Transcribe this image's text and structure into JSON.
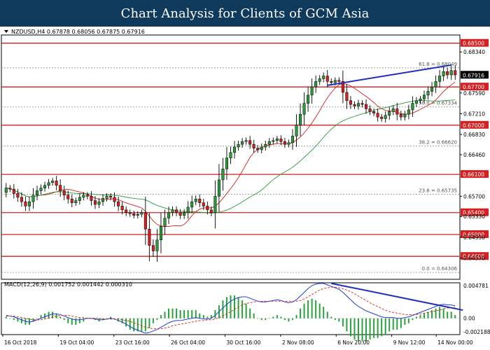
{
  "banner": {
    "title": "Chart Analysis for Clients of GCM Asia"
  },
  "chart_data": [
    {
      "type": "candlestick",
      "symbol_header": "NZDUSD,H4  0.67878 0.68056 0.67875 0.67916",
      "last_price": "0.67916",
      "ylim": [
        0.6418,
        0.6865
      ],
      "x_ticks": [
        "16 Oct 2018",
        "19 Oct 04:00",
        "23 Oct 16:00",
        "26 Oct 04:00",
        "30 Oct 16:00",
        "2 Nov 08:00",
        "6 Nov 20:00",
        "9 Nov 12:00",
        "14 Nov 00:00"
      ],
      "y_ticks": [
        "0.68340",
        "0.67590",
        "0.67210",
        "0.66830",
        "0.66460",
        "0.65700",
        "0.65330",
        "0.64950",
        "0.64570",
        "0.64200"
      ],
      "horizontal_levels": [
        {
          "label": "0.68500",
          "value": 0.685
        },
        {
          "label": "0.67700",
          "value": 0.677
        },
        {
          "label": "0.67000",
          "value": 0.67
        },
        {
          "label": "0.66100",
          "value": 0.661
        },
        {
          "label": "0.65400",
          "value": 0.654
        },
        {
          "label": "0.65000",
          "value": 0.65
        },
        {
          "label": "0.64600",
          "value": 0.646
        }
      ],
      "fibonacci": [
        {
          "label": "61.8 = 0.68049",
          "value": 0.68049
        },
        {
          "label": "50.0 = 0.67334",
          "value": 0.67334
        },
        {
          "label": "38.2 = 0.66620",
          "value": 0.6662
        },
        {
          "label": "23.6 = 0.65735",
          "value": 0.65735
        },
        {
          "label": "0.0 = 0.64306",
          "value": 0.64306
        }
      ],
      "trendline": {
        "from": [
          83,
          0.6773
        ],
        "to": [
          115,
          0.681
        ]
      },
      "moving_average_colors": [
        "#d42020",
        "#2a9a3a"
      ],
      "closes": [
        0.6585,
        0.6583,
        0.6575,
        0.6568,
        0.656,
        0.6552,
        0.656,
        0.6572,
        0.658,
        0.6585,
        0.659,
        0.6595,
        0.6598,
        0.659,
        0.658,
        0.6572,
        0.6565,
        0.6558,
        0.6562,
        0.6568,
        0.6572,
        0.657,
        0.6562,
        0.6555,
        0.656,
        0.6566,
        0.657,
        0.6568,
        0.656,
        0.6552,
        0.6545,
        0.654,
        0.6538,
        0.6535,
        0.6537,
        0.654,
        0.651,
        0.648,
        0.647,
        0.649,
        0.6515,
        0.653,
        0.654,
        0.6545,
        0.654,
        0.6535,
        0.654,
        0.655,
        0.656,
        0.6565,
        0.6558,
        0.6552,
        0.6545,
        0.654,
        0.657,
        0.66,
        0.662,
        0.664,
        0.665,
        0.666,
        0.6665,
        0.667,
        0.6672,
        0.6665,
        0.6658,
        0.6655,
        0.666,
        0.6665,
        0.667,
        0.6672,
        0.6675,
        0.667,
        0.6665,
        0.6668,
        0.668,
        0.67,
        0.672,
        0.674,
        0.6755,
        0.677,
        0.678,
        0.6785,
        0.679,
        0.678,
        0.6778,
        0.6782,
        0.678,
        0.676,
        0.6745,
        0.6738,
        0.6735,
        0.674,
        0.6738,
        0.673,
        0.6725,
        0.6722,
        0.6715,
        0.6712,
        0.6718,
        0.6725,
        0.673,
        0.672,
        0.6715,
        0.672,
        0.6728,
        0.674,
        0.6745,
        0.6748,
        0.6755,
        0.6762,
        0.677,
        0.678,
        0.679,
        0.6798,
        0.6792,
        0.68,
        0.6792
      ],
      "macd": {
        "label": "MACD(12,26,9) 0.001752 0.001442 0.000310",
        "y_ticks": [
          "0.004781",
          "0.00",
          "-0.002188"
        ],
        "ylim": [
          -0.00219,
          0.00478
        ],
        "main": [
          0.0004,
          0.0003,
          0.0002,
          0.0,
          -0.0002,
          -0.0004,
          -0.0005,
          -0.0004,
          -0.0002,
          0.0,
          0.0002,
          0.0004,
          0.0006,
          0.0006,
          0.0005,
          0.0003,
          0.0001,
          -0.0001,
          -0.0002,
          -0.0002,
          -0.0001,
          0.0,
          0.0,
          -0.0001,
          -0.0002,
          -0.0002,
          -0.0001,
          0.0,
          -0.0001,
          -0.0003,
          -0.0005,
          -0.0008,
          -0.0011,
          -0.0014,
          -0.0016,
          -0.0018,
          -0.002,
          -0.0019,
          -0.0017,
          -0.0015,
          -0.0012,
          -0.0009,
          -0.0006,
          -0.0004,
          -0.0003,
          -0.0003,
          -0.0002,
          -0.0001,
          0.0,
          0.0001,
          0.0,
          -0.0001,
          -0.0001,
          0.0,
          0.0004,
          0.0009,
          0.0014,
          0.0019,
          0.0023,
          0.0026,
          0.0028,
          0.0029,
          0.0029,
          0.0027,
          0.0025,
          0.0023,
          0.0022,
          0.0022,
          0.0023,
          0.0024,
          0.0025,
          0.0024,
          0.0022,
          0.0021,
          0.0022,
          0.0025,
          0.003,
          0.0035,
          0.004,
          0.0044,
          0.0046,
          0.0047,
          0.0047,
          0.0045,
          0.0043,
          0.0041,
          0.0039,
          0.0035,
          0.003,
          0.0025,
          0.002,
          0.0016,
          0.0013,
          0.001,
          0.0008,
          0.0006,
          0.0004,
          0.0002,
          0.0001,
          0.0001,
          0.0001,
          0.0,
          0.0,
          0.0001,
          0.0002,
          0.0004,
          0.0006,
          0.0008,
          0.001,
          0.0012,
          0.0014,
          0.0016,
          0.0018,
          0.0019,
          0.0018,
          0.0018,
          0.0017
        ],
        "signal": [
          0.0003,
          0.0003,
          0.0003,
          0.0002,
          0.0001,
          0.0,
          -0.0001,
          -0.0002,
          -0.0002,
          -0.0002,
          -0.0001,
          0.0,
          0.0002,
          0.0003,
          0.0004,
          0.0004,
          0.0004,
          0.0003,
          0.0002,
          0.0001,
          0.0001,
          0.0,
          0.0,
          0.0,
          0.0,
          -0.0001,
          -0.0001,
          -0.0001,
          -0.0001,
          -0.0001,
          -0.0002,
          -0.0003,
          -0.0004,
          -0.0006,
          -0.0008,
          -0.001,
          -0.0012,
          -0.0013,
          -0.0014,
          -0.0014,
          -0.0014,
          -0.0013,
          -0.0012,
          -0.001,
          -0.0009,
          -0.0008,
          -0.0007,
          -0.0006,
          -0.0005,
          -0.0004,
          -0.0003,
          -0.0003,
          -0.0002,
          -0.0002,
          -0.0001,
          0.0001,
          0.0003,
          0.0006,
          0.0009,
          0.0012,
          0.0015,
          0.0018,
          0.002,
          0.0021,
          0.0022,
          0.0023,
          0.0023,
          0.0023,
          0.0023,
          0.0023,
          0.0023,
          0.0023,
          0.0023,
          0.0023,
          0.0023,
          0.0023,
          0.0024,
          0.0026,
          0.0029,
          0.0032,
          0.0035,
          0.0038,
          0.004,
          0.0041,
          0.0042,
          0.0042,
          0.0041,
          0.004,
          0.0038,
          0.0036,
          0.0033,
          0.003,
          0.0027,
          0.0024,
          0.0021,
          0.0018,
          0.0016,
          0.0013,
          0.0011,
          0.0009,
          0.0008,
          0.0007,
          0.0006,
          0.0005,
          0.0005,
          0.0005,
          0.0005,
          0.0006,
          0.0007,
          0.0008,
          0.0009,
          0.001,
          0.0011,
          0.0013,
          0.0014,
          0.0014,
          0.0015
        ],
        "trendline": {
          "from": [
            84,
            0.0047
          ],
          "to": [
            118,
            0.0011
          ]
        },
        "colors": {
          "main": "#1f3fd6",
          "signal": "#d42020",
          "histogram": "#27a33a"
        }
      }
    }
  ],
  "colors": {
    "banner": "#0f3a5c",
    "level": "#d42020",
    "trend": "#1f2fb8"
  }
}
